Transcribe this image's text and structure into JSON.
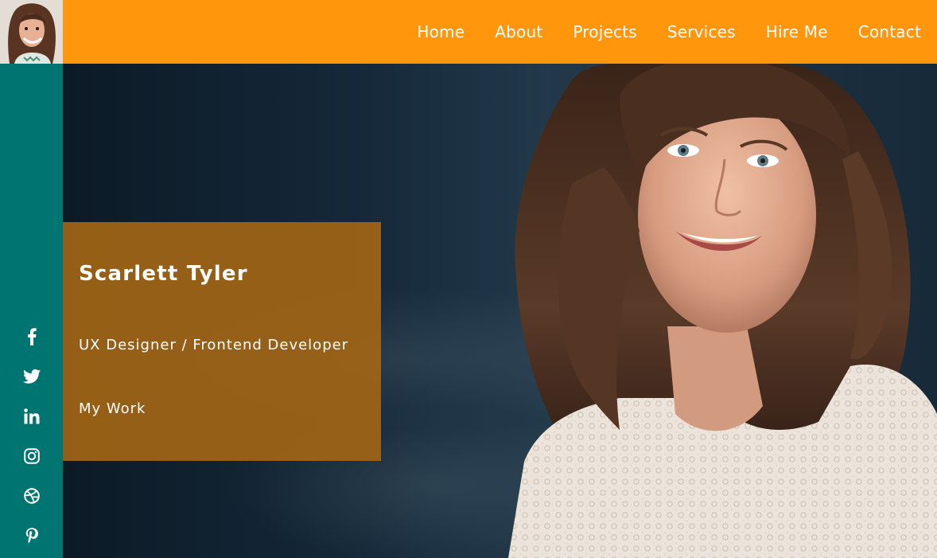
{
  "nav": {
    "items": [
      {
        "label": "Home"
      },
      {
        "label": "About"
      },
      {
        "label": "Projects"
      },
      {
        "label": "Services"
      },
      {
        "label": "Hire Me"
      },
      {
        "label": "Contact"
      }
    ]
  },
  "sidebar": {
    "social": [
      {
        "icon": "facebook-icon"
      },
      {
        "icon": "twitter-icon"
      },
      {
        "icon": "linkedin-icon"
      },
      {
        "icon": "instagram-icon"
      },
      {
        "icon": "dribbble-icon"
      },
      {
        "icon": "pinterest-icon"
      }
    ]
  },
  "hero": {
    "name": "Scarlett Tyler",
    "role": "UX Designer / Frontend Developer",
    "cta": "My Work"
  },
  "colors": {
    "nav_bg": "#ff960c",
    "sidebar_bg": "#007471",
    "card_bg": "#a0641a",
    "text": "#ffffff"
  }
}
